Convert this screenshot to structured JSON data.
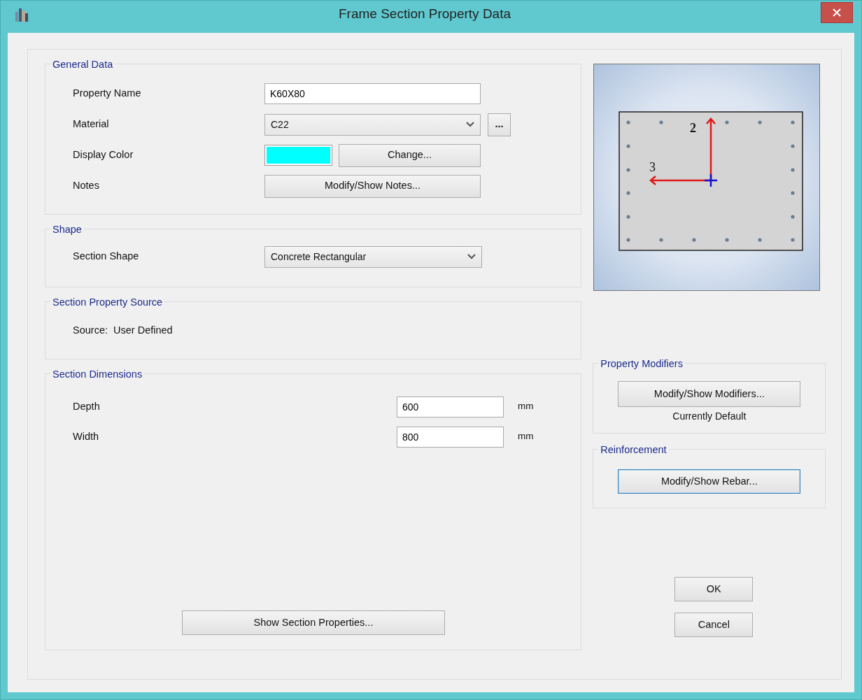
{
  "window": {
    "title": "Frame Section Property Data"
  },
  "general_data": {
    "title": "General Data",
    "fields": [
      {
        "kind": "text",
        "label": "Property Name",
        "value": "K60X80"
      },
      {
        "kind": "select",
        "label": "Material",
        "value": "C22",
        "more": "..."
      },
      {
        "kind": "color",
        "label": "Display Color",
        "color": "#00ffff",
        "button": "Change..."
      },
      {
        "kind": "button",
        "label": "Notes",
        "button": "Modify/Show Notes..."
      }
    ]
  },
  "shape": {
    "title": "Shape",
    "fields": [
      {
        "kind": "select",
        "label": "Section Shape",
        "value": "Concrete Rectangular"
      }
    ]
  },
  "source": {
    "title": "Section Property Source",
    "text": "Source:  User Defined"
  },
  "dimensions": {
    "title": "Section Dimensions",
    "fields": [
      {
        "label": "Depth",
        "value": "600",
        "unit": "mm"
      },
      {
        "label": "Width",
        "value": "800",
        "unit": "mm"
      }
    ],
    "button": "Show Section Properties..."
  },
  "preview": {
    "axis_labels": [
      "2",
      "3"
    ]
  },
  "property_modifiers": {
    "title": "Property Modifiers",
    "button": "Modify/Show Modifiers...",
    "status": "Currently Default"
  },
  "reinforcement": {
    "title": "Reinforcement",
    "button": "Modify/Show Rebar...",
    "focused": true
  },
  "buttons": [
    "OK",
    "Cancel"
  ]
}
